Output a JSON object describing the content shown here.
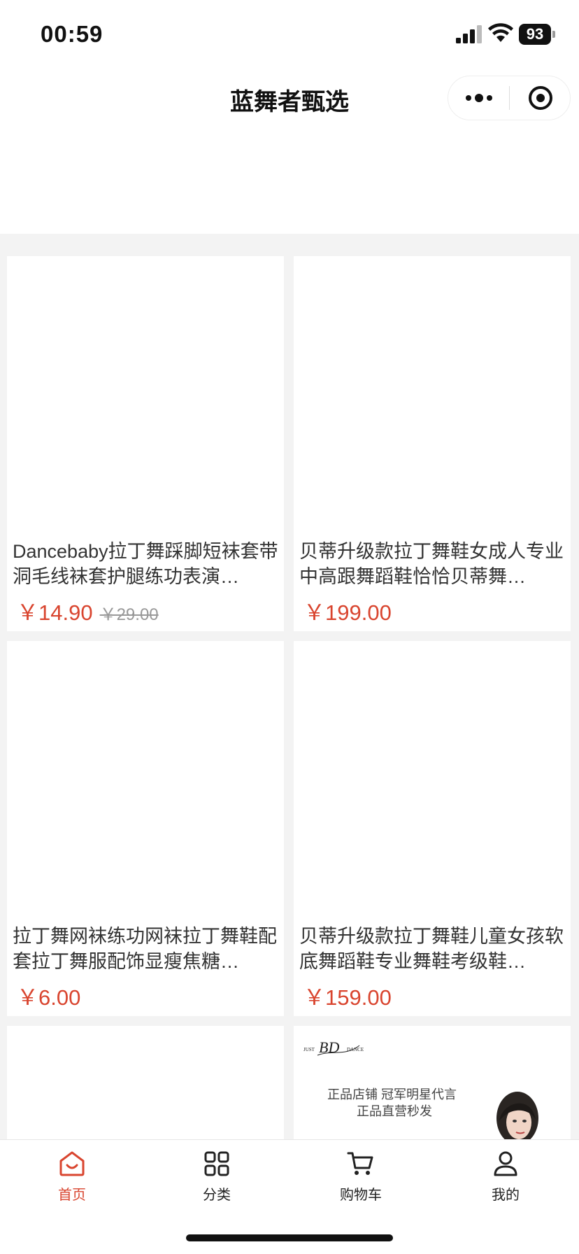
{
  "status_bar": {
    "time": "00:59",
    "battery": "93"
  },
  "header": {
    "title": "蓝舞者甄选"
  },
  "products": [
    {
      "title": "Dancebaby拉丁舞踩脚短袜套带洞毛线袜套护腿练功表演…",
      "price": "￥14.90",
      "old_price": "￥29.00"
    },
    {
      "title": "贝蒂升级款拉丁舞鞋女成人专业中高跟舞蹈鞋恰恰贝蒂舞…",
      "price": "￥199.00",
      "old_price": ""
    },
    {
      "title": "拉丁舞网袜练功网袜拉丁舞鞋配套拉丁舞服配饰显瘦焦糖…",
      "price": "￥6.00",
      "old_price": ""
    },
    {
      "title": "贝蒂升级款拉丁舞鞋儿童女孩软底舞蹈鞋专业舞鞋考级鞋…",
      "price": "￥159.00",
      "old_price": ""
    }
  ],
  "ad": {
    "logo_text": "JUST BD DANCE",
    "line1": "正品店铺 冠军明星代言",
    "line2": "正品直营秒发"
  },
  "tabs": [
    {
      "label": "首页",
      "icon": "home-icon",
      "active": true
    },
    {
      "label": "分类",
      "icon": "category-grid-icon",
      "active": false
    },
    {
      "label": "购物车",
      "icon": "cart-icon",
      "active": false
    },
    {
      "label": "我的",
      "icon": "user-icon",
      "active": false
    }
  ],
  "colors": {
    "accent": "#d9452f",
    "background": "#f3f3f3"
  }
}
